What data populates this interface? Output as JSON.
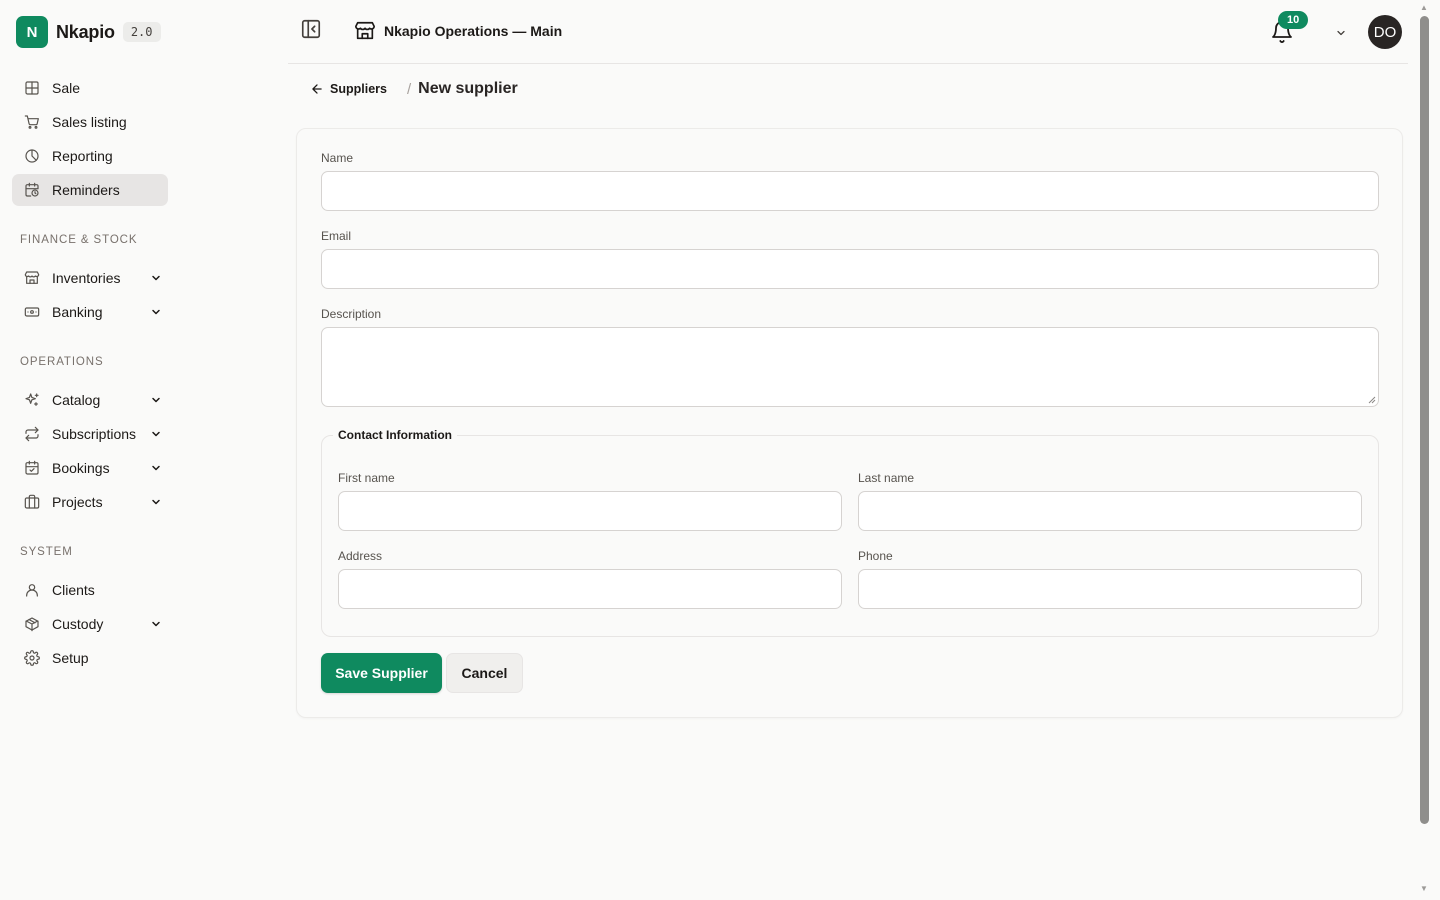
{
  "app": {
    "name": "Nkapio",
    "version": "2.0",
    "logo_letter": "N",
    "brand_color": "#0f8a5f"
  },
  "sidebar": {
    "main_items": [
      {
        "label": "Sale",
        "icon": "grid-plus-icon"
      },
      {
        "label": "Sales listing",
        "icon": "cart-icon"
      },
      {
        "label": "Reporting",
        "icon": "pie-chart-icon"
      },
      {
        "label": "Reminders",
        "icon": "calendar-clock-icon",
        "active": true
      }
    ],
    "sections": [
      {
        "title": "FINANCE & STOCK",
        "items": [
          {
            "label": "Inventories",
            "icon": "store-icon",
            "expandable": true
          },
          {
            "label": "Banking",
            "icon": "banknote-icon",
            "expandable": true
          }
        ]
      },
      {
        "title": "OPERATIONS",
        "items": [
          {
            "label": "Catalog",
            "icon": "sparkles-icon",
            "expandable": true
          },
          {
            "label": "Subscriptions",
            "icon": "repeat-icon",
            "expandable": true
          },
          {
            "label": "Bookings",
            "icon": "calendar-check-icon",
            "expandable": true
          },
          {
            "label": "Projects",
            "icon": "folder-kanban-icon",
            "expandable": true
          }
        ]
      },
      {
        "title": "SYSTEM",
        "items": [
          {
            "label": "Clients",
            "icon": "user-icon",
            "expandable": false
          },
          {
            "label": "Custody",
            "icon": "package-icon",
            "expandable": true
          },
          {
            "label": "Setup",
            "icon": "gear-icon",
            "expandable": false
          }
        ]
      }
    ]
  },
  "header": {
    "store_title": "Nkapio Operations — Main",
    "notification_count": "10",
    "avatar_initials": "DO"
  },
  "breadcrumb": {
    "back_label": "Suppliers",
    "separator": "/",
    "current": "New supplier"
  },
  "form": {
    "name_label": "Name",
    "name_value": "",
    "email_label": "Email",
    "email_value": "",
    "description_label": "Description",
    "description_value": "",
    "contact_legend": "Contact Information",
    "first_name_label": "First name",
    "first_name_value": "",
    "last_name_label": "Last name",
    "last_name_value": "",
    "address_label": "Address",
    "address_value": "",
    "phone_label": "Phone",
    "phone_value": "",
    "save_label": "Save Supplier",
    "cancel_label": "Cancel"
  }
}
